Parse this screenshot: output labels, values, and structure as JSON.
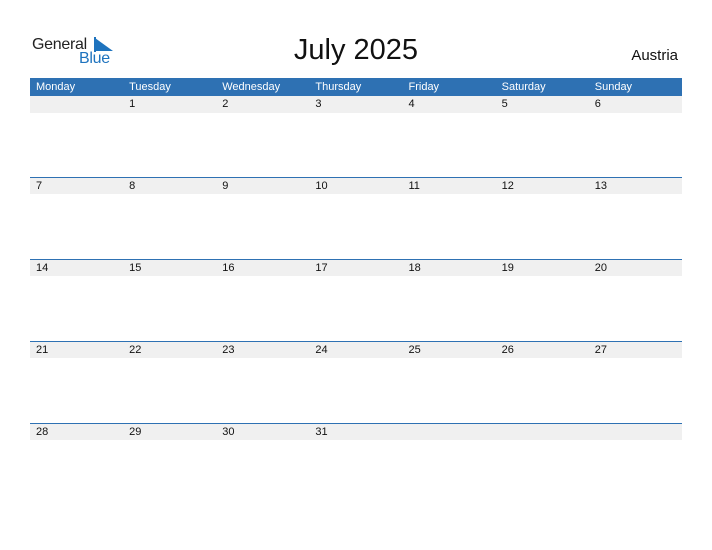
{
  "logo": {
    "general": "General",
    "blue": "Blue",
    "accent_color": "#1e73be"
  },
  "title": "July 2025",
  "country": "Austria",
  "header_color": "#2e71b3",
  "weekdays": [
    "Monday",
    "Tuesday",
    "Wednesday",
    "Thursday",
    "Friday",
    "Saturday",
    "Sunday"
  ],
  "weeks": [
    [
      "",
      "1",
      "2",
      "3",
      "4",
      "5",
      "6"
    ],
    [
      "7",
      "8",
      "9",
      "10",
      "11",
      "12",
      "13"
    ],
    [
      "14",
      "15",
      "16",
      "17",
      "18",
      "19",
      "20"
    ],
    [
      "21",
      "22",
      "23",
      "24",
      "25",
      "26",
      "27"
    ],
    [
      "28",
      "29",
      "30",
      "31",
      "",
      "",
      ""
    ]
  ]
}
